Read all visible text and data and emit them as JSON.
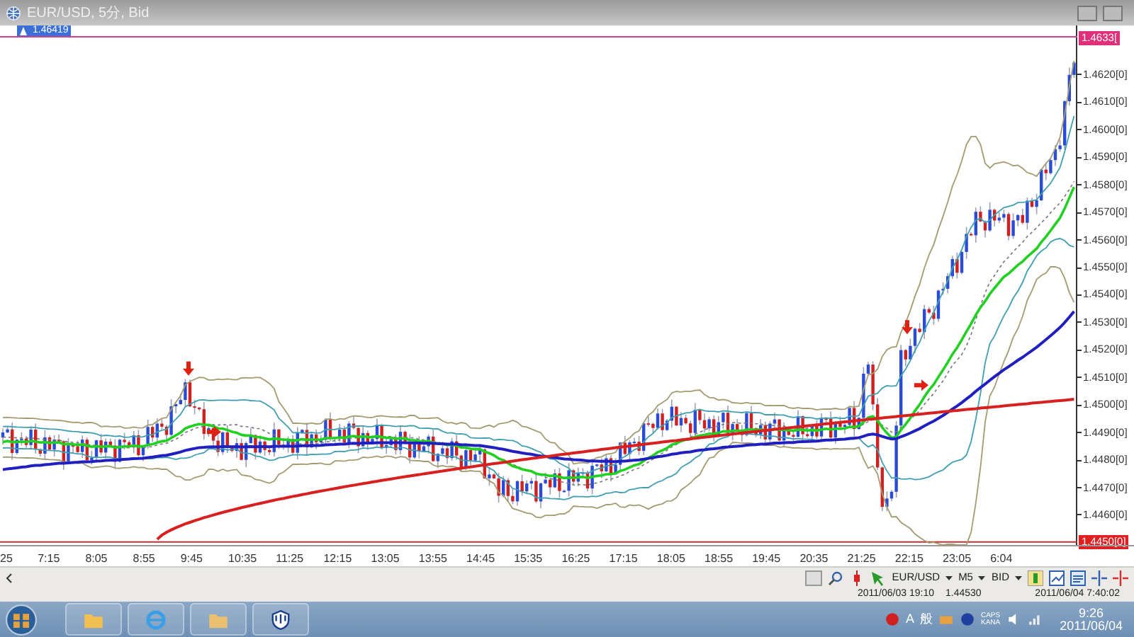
{
  "window": {
    "title": "EUR/USD, 5分, Bid"
  },
  "price_badge": "1.46419",
  "chart": {
    "current_price_tag": "1.4633[",
    "low_tag": "1.4450[0]",
    "price_labels": [
      "1.4620[0]",
      "1.4610[0]",
      "1.4600[0]",
      "1.4590[0]",
      "1.4580[0]",
      "1.4570[0]",
      "1.4560[0]",
      "1.4550[0]",
      "1.4540[0]",
      "1.4530[0]",
      "1.4520[0]",
      "1.4510[0]",
      "1.4500[0]",
      "1.4490[0]",
      "1.4480[0]",
      "1.4470[0]",
      "1.4460[0]"
    ],
    "time_labels": [
      "25",
      "7:15",
      "8:05",
      "8:55",
      "9:45",
      "10:35",
      "11:25",
      "12:15",
      "13:05",
      "13:55",
      "14:45",
      "15:35",
      "16:25",
      "17:15",
      "18:05",
      "18:55",
      "19:45",
      "20:35",
      "21:25",
      "22:15",
      "23:05",
      "6:04"
    ]
  },
  "toolbar": {
    "symbol": "EUR/USD",
    "timeframe": "M5",
    "price_type": "BID"
  },
  "status_bar": {
    "cursor_time": "2011/06/03 19:10",
    "cursor_price": "1.44530",
    "server_time": "2011/06/04 7:40:02"
  },
  "taskbar": {
    "ime": [
      "A",
      "般"
    ],
    "lock_keys": [
      "CAPS",
      "KANA"
    ],
    "clock_time": "9:26",
    "clock_date": "2011/06/04"
  }
}
